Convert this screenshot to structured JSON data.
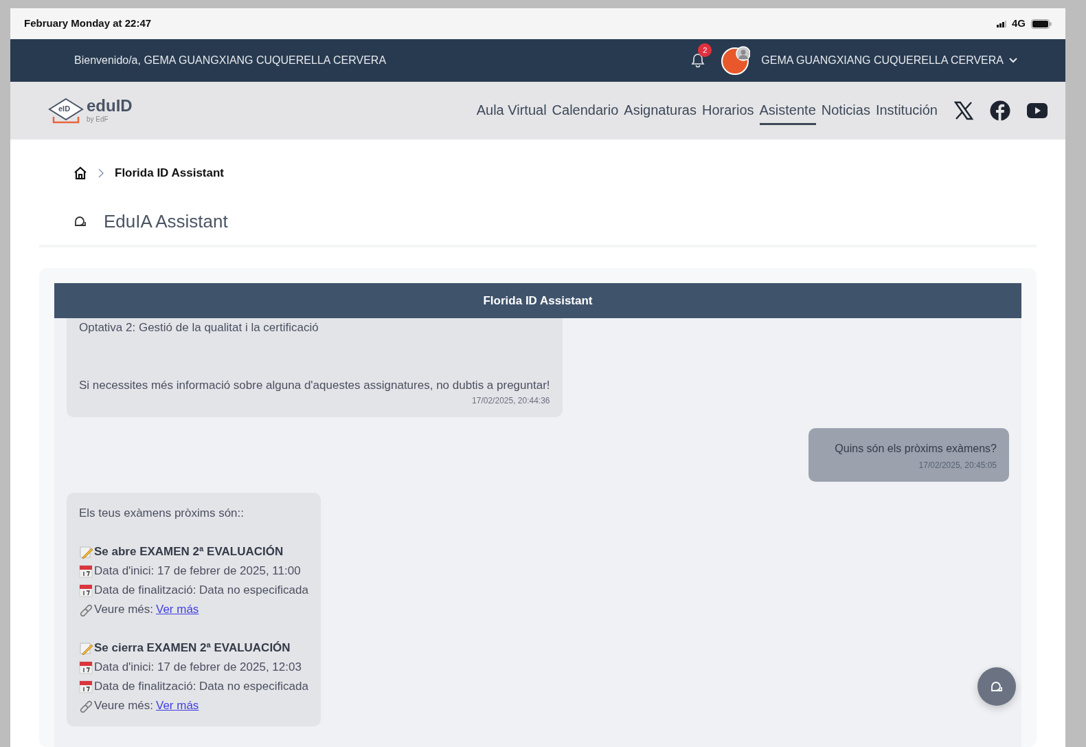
{
  "status_bar": {
    "time": "February Monday at 22:47",
    "network": "4G"
  },
  "top_bar": {
    "welcome": "Bienvenido/a, GEMA GUANGXIANG CUQUERELLA CERVERA",
    "notifications": "2",
    "user_name": "GEMA GUANGXIANG CUQUERELLA CERVERA"
  },
  "brand": {
    "name": "eduID",
    "tagline": "by EdF",
    "badge": "eID"
  },
  "nav": [
    {
      "label": "Aula Virtual",
      "selected": false
    },
    {
      "label": "Calendario",
      "selected": false
    },
    {
      "label": "Asignaturas",
      "selected": false
    },
    {
      "label": "Horarios",
      "selected": false
    },
    {
      "label": "Asistente",
      "selected": true
    },
    {
      "label": "Noticias",
      "selected": false
    },
    {
      "label": "Institución",
      "selected": false
    }
  ],
  "breadcrumb": {
    "current": "Florida ID Assistant"
  },
  "page_title": "EduIA Assistant",
  "chat": {
    "title": "Florida ID Assistant",
    "messages": [
      {
        "kind": "bot",
        "lines": [
          "Optativa 2: Gestió de la qualitat i la certificació",
          "Si necessites més informació sobre alguna d'aquestes assignatures, no dubtis a preguntar!"
        ],
        "time": "17/02/2025, 20:44:36"
      },
      {
        "kind": "user",
        "lines": [
          "Quins són els pròxims exàmens?"
        ],
        "time": "17/02/2025, 20:45:05"
      },
      {
        "kind": "bot",
        "lines": [
          "Els teus exàmens pròxims són::"
        ],
        "exams": [
          {
            "title": "Se abre EXAMEN 2ª EVALUACIÓN",
            "start": "Data d'inici: 17 de febrer de 2025, 11:00",
            "end": "Data de finalització: Data no especificada",
            "more_label": "Veure més:",
            "link": "Ver más"
          },
          {
            "title": "Se cierra EXAMEN 2ª EVALUACIÓN",
            "start": "Data d'inici: 17 de febrer de 2025, 12:03",
            "end": "Data de finalització: Data no especificada",
            "more_label": "Veure més:",
            "link": "Ver más"
          }
        ]
      }
    ]
  }
}
